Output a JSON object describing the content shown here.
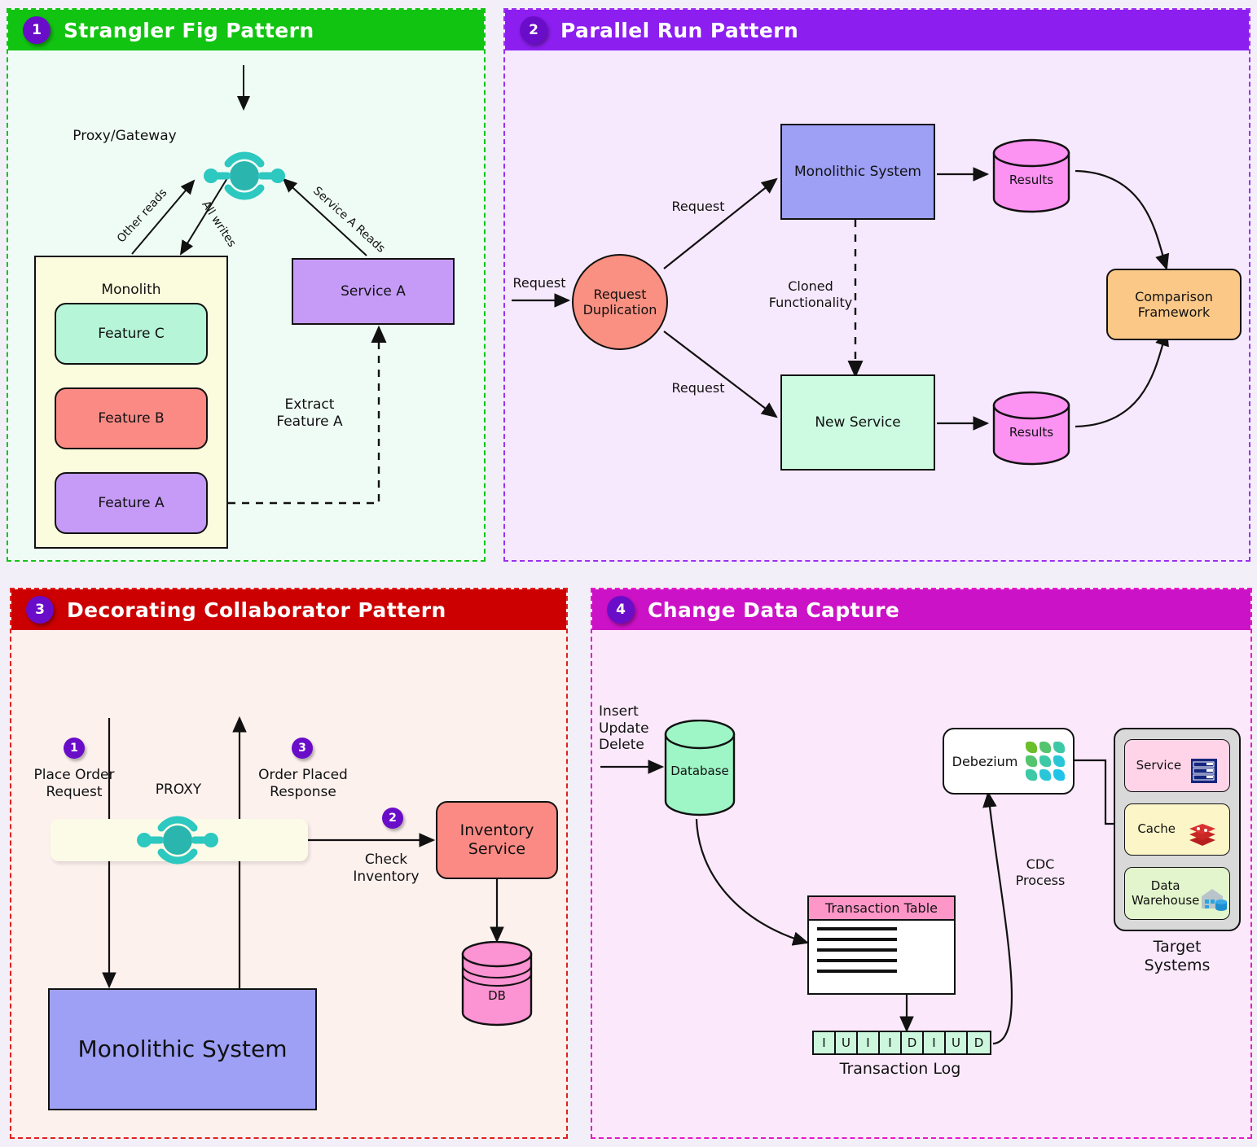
{
  "panels": [
    {
      "number": "1",
      "title": "Strangler Fig Pattern",
      "accent": "#12c412",
      "nodes": {
        "proxy_label": "Proxy/Gateway",
        "monolith": "Monolith",
        "feature_c": "Feature C",
        "feature_b": "Feature B",
        "feature_a": "Feature A",
        "service_a": "Service A"
      },
      "edges": {
        "other_reads": "Other reads",
        "all_writes": "All writes",
        "service_a_reads": "Service A Reads",
        "extract_feature_a": "Extract\nFeature A"
      }
    },
    {
      "number": "2",
      "title": "Parallel Run Pattern",
      "accent": "#8c1ef0",
      "nodes": {
        "request_duplication": "Request\nDuplication",
        "monolithic_system": "Monolithic System",
        "new_service": "New Service",
        "results_top": "Results",
        "results_bottom": "Results",
        "comparison_framework": "Comparison\nFramework"
      },
      "edges": {
        "request_in": "Request",
        "request_top": "Request",
        "request_bottom": "Request",
        "cloned_functionality": "Cloned\nFunctionality"
      }
    },
    {
      "number": "3",
      "title": "Decorating Collaborator Pattern",
      "accent": "#cc0000",
      "nodes": {
        "proxy_label": "PROXY",
        "inventory_service": "Inventory\nService",
        "db": "DB",
        "monolithic_system": "Monolithic System"
      },
      "steps": [
        {
          "num": "1",
          "label": "Place Order\nRequest"
        },
        {
          "num": "2",
          "label": "Check\nInventory"
        },
        {
          "num": "3",
          "label": "Order Placed\nResponse"
        }
      ]
    },
    {
      "number": "4",
      "title": "Change Data Capture",
      "accent": "#cc12c6",
      "nodes": {
        "operations": "Insert\nUpdate\nDelete",
        "database": "Database",
        "transaction_table": "Transaction Table",
        "transaction_log": "Transaction Log",
        "debezium": "Debezium",
        "target_systems": "Target\nSystems"
      },
      "edges": {
        "cdc_process": "CDC\nProcess"
      },
      "log_cells": [
        "I",
        "U",
        "I",
        "I",
        "D",
        "I",
        "U",
        "D"
      ],
      "targets": [
        {
          "label": "Service",
          "icon": "server-icon",
          "color": "#ffd4e8"
        },
        {
          "label": "Cache",
          "icon": "redis-icon",
          "color": "#fbf5c8"
        },
        {
          "label": "Data\nWarehouse",
          "icon": "warehouse-icon",
          "color": "#e2f5cc"
        }
      ]
    }
  ],
  "colors": {
    "monolith_fill": "#fbfbdd",
    "feature_c": "#b6f5d8",
    "feature_b": "#fb8a85",
    "service_a": "#c59bf7",
    "feature_a": "#c59bf7",
    "monolithic_system": "#9ea0f5",
    "new_service": "#ccfbe2",
    "results": "#fc92f2",
    "comparison": "#fbc887",
    "request_dup": "#fa9081",
    "inventory": "#fb8a85",
    "db_pink": "#fc93d2",
    "database_green": "#9ef5c5",
    "teal": "#2dc8c0"
  }
}
